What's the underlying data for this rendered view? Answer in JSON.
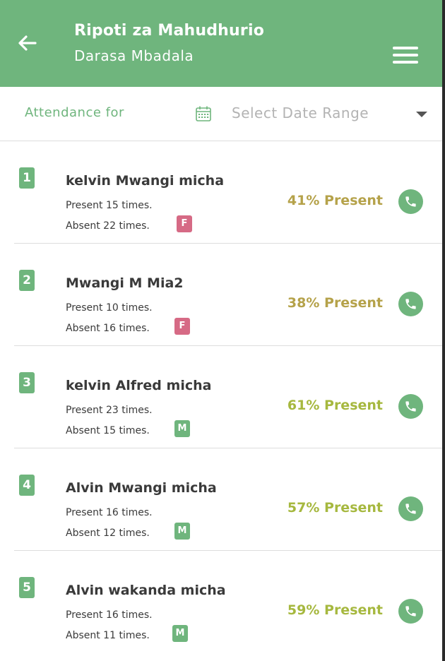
{
  "header": {
    "title": "Ripoti za Mahudhurio",
    "subtitle": "Darasa Mbadala"
  },
  "filter": {
    "label": "Attendance for",
    "date_placeholder": "Select Date Range"
  },
  "colors": {
    "primary": "#6fb57d",
    "female_badge": "#d66a85",
    "low_pct": "#b5a24a",
    "high_pct": "#a6b83f"
  },
  "students": [
    {
      "index": "1",
      "name": "kelvin Mwangi micha",
      "present": "Present 15 times.",
      "absent": "Absent 22 times.",
      "gender": "F",
      "percent": "41% Present"
    },
    {
      "index": "2",
      "name": "Mwangi M Mia2",
      "present": "Present 10 times.",
      "absent": "Absent 16 times.",
      "gender": "F",
      "percent": "38% Present"
    },
    {
      "index": "3",
      "name": "kelvin Alfred micha",
      "present": "Present 23 times.",
      "absent": "Absent 15 times.",
      "gender": "M",
      "percent": "61% Present"
    },
    {
      "index": "4",
      "name": "Alvin Mwangi micha",
      "present": "Present 16 times.",
      "absent": "Absent 12 times.",
      "gender": "M",
      "percent": "57% Present"
    },
    {
      "index": "5",
      "name": "Alvin wakanda micha",
      "present": "Present 16 times.",
      "absent": "Absent 11 times.",
      "gender": "M",
      "percent": "59% Present"
    }
  ]
}
